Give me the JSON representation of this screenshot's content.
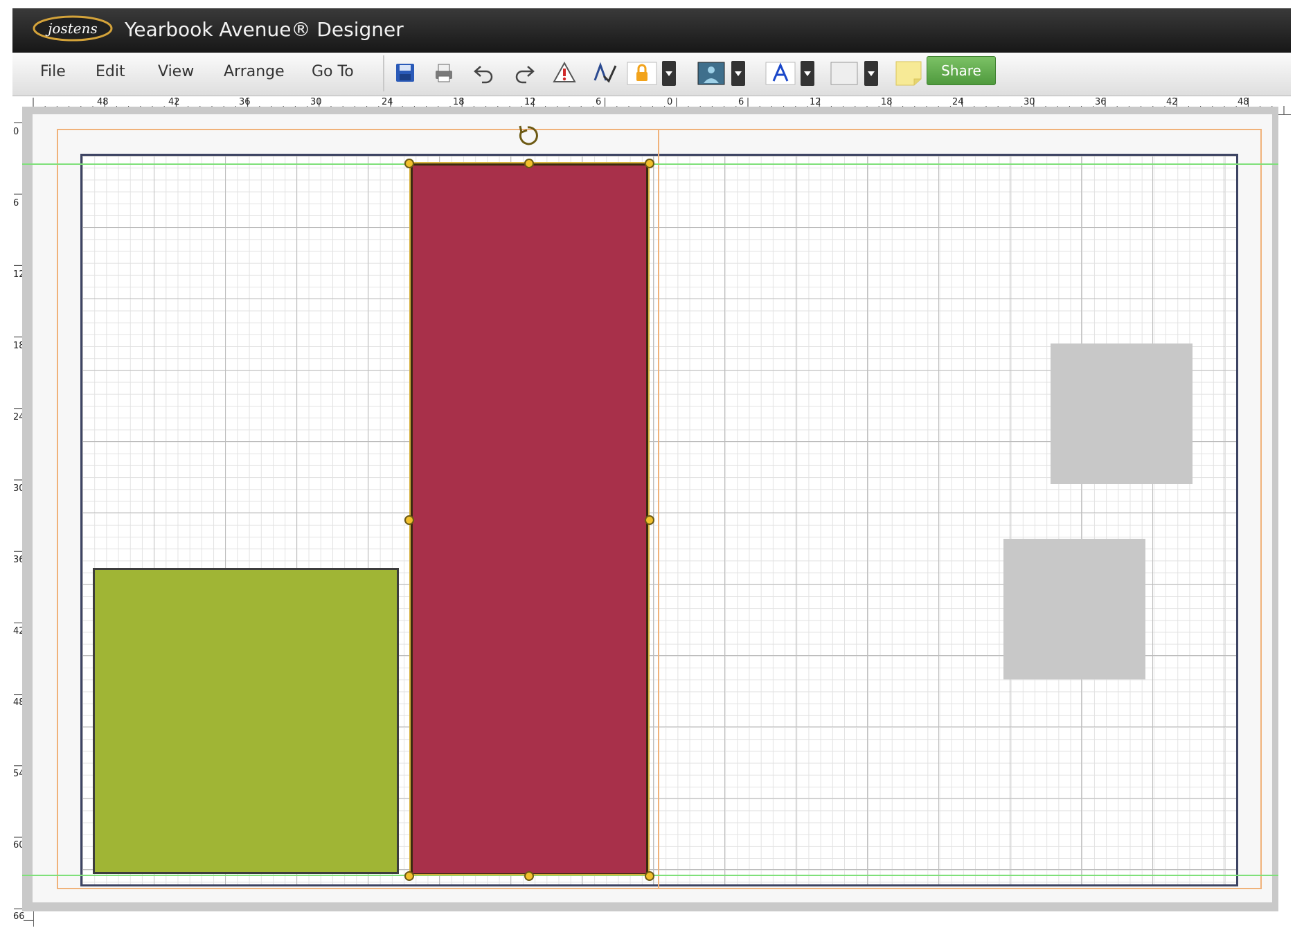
{
  "app": {
    "logo_text": "jostens",
    "title": "Yearbook Avenue® Designer"
  },
  "menu": {
    "items": [
      "File",
      "Edit",
      "View",
      "Arrange",
      "Go To"
    ]
  },
  "toolbar": {
    "icons": [
      "save-icon",
      "print-icon",
      "undo-icon",
      "redo-icon",
      "warning-icon",
      "spellcheck-icon",
      "lock-icon",
      "image-color-icon",
      "text-color-icon",
      "fill-color-icon",
      "sticky-note-icon"
    ],
    "share_label": "Share",
    "share_color": "#5aa845"
  },
  "rulers": {
    "horizontal_labels": [
      "48",
      "42",
      "36",
      "30",
      "24",
      "18",
      "12",
      "6",
      "0",
      "6",
      "12",
      "18",
      "24",
      "30",
      "36",
      "42",
      "48"
    ],
    "vertical_labels": [
      "0",
      "6",
      "12",
      "18",
      "24",
      "30",
      "36",
      "42",
      "48",
      "54",
      "60",
      "66"
    ]
  },
  "canvas": {
    "colors": {
      "green_shape": "#a0b535",
      "red_shape": "#a8304a",
      "gray_shape": "#c8c8c8",
      "guide": "#7fe07a",
      "margin": "#f0b27a",
      "border": "#3d4463"
    }
  }
}
